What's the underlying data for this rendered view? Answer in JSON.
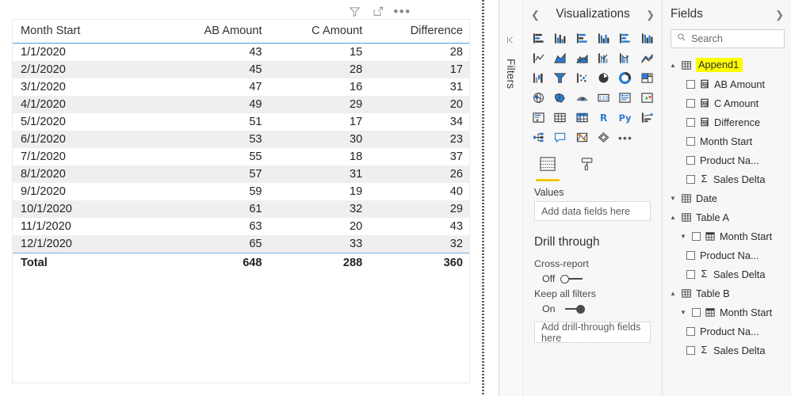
{
  "visual": {
    "toolbar": [
      {
        "name": "filter-icon",
        "label": "Filter"
      },
      {
        "name": "focus-mode-icon",
        "label": "Focus mode"
      },
      {
        "name": "more-options-icon",
        "label": "More options"
      }
    ],
    "table": {
      "columns": [
        "Month Start",
        "AB Amount",
        "C Amount",
        "Difference"
      ],
      "rows": [
        [
          "1/1/2020",
          "43",
          "15",
          "28"
        ],
        [
          "2/1/2020",
          "45",
          "28",
          "17"
        ],
        [
          "3/1/2020",
          "47",
          "16",
          "31"
        ],
        [
          "4/1/2020",
          "49",
          "29",
          "20"
        ],
        [
          "5/1/2020",
          "51",
          "17",
          "34"
        ],
        [
          "6/1/2020",
          "53",
          "30",
          "23"
        ],
        [
          "7/1/2020",
          "55",
          "18",
          "37"
        ],
        [
          "8/1/2020",
          "57",
          "31",
          "26"
        ],
        [
          "9/1/2020",
          "59",
          "19",
          "40"
        ],
        [
          "10/1/2020",
          "61",
          "32",
          "29"
        ],
        [
          "11/1/2020",
          "63",
          "20",
          "43"
        ],
        [
          "12/1/2020",
          "65",
          "33",
          "32"
        ]
      ],
      "total": [
        "Total",
        "648",
        "288",
        "360"
      ]
    }
  },
  "filters_rail": {
    "label": "Filters",
    "expand_icon": "expand-filters-icon"
  },
  "visualizations": {
    "title": "Visualizations",
    "collapse_icon": "chevron-left-icon",
    "expand_icon": "chevron-right-icon",
    "icons": [
      "stacked-bar-chart",
      "stacked-column-chart",
      "clustered-bar-chart",
      "clustered-column-chart",
      "100-stacked-bar-chart",
      "100-stacked-column-chart",
      "line-chart",
      "area-chart",
      "stacked-area-chart",
      "line-and-stacked-column-chart",
      "line-and-clustered-column-chart",
      "ribbon-chart",
      "waterfall-chart",
      "funnel-chart",
      "scatter-chart",
      "pie-chart",
      "donut-chart",
      "treemap",
      "map",
      "filled-map",
      "arcgis-map",
      "card",
      "multi-row-card",
      "kpi",
      "slicer",
      "table",
      "matrix",
      "r-script-visual",
      "python-visual",
      "key-influencers",
      "decomposition-tree",
      "q-and-a",
      "arcgis-maps-visual",
      "paginated-report",
      "more-visuals"
    ],
    "tabs": [
      {
        "label": "Fields",
        "icon": "fields-grid-icon",
        "active": true
      },
      {
        "label": "Format",
        "icon": "paint-roller-icon",
        "active": false
      }
    ],
    "values_label": "Values",
    "values_placeholder": "Add data fields here",
    "drill_through": {
      "title": "Drill through",
      "cross_report_label": "Cross-report",
      "cross_report_state": "Off",
      "keep_all_filters_label": "Keep all filters",
      "keep_all_filters_state": "On",
      "placeholder": "Add drill-through fields here"
    },
    "accent_color": "#f2c811"
  },
  "fields": {
    "title": "Fields",
    "expand_icon": "chevron-right-icon",
    "search_placeholder": "Search",
    "search_icon": "search-icon",
    "tables": [
      {
        "name": "Append1",
        "expanded": true,
        "highlighted": true,
        "fields": [
          {
            "label": "AB Amount",
            "icon": "measure-icon",
            "checked": false
          },
          {
            "label": "C Amount",
            "icon": "measure-icon",
            "checked": false
          },
          {
            "label": "Difference",
            "icon": "measure-icon",
            "checked": false
          },
          {
            "label": "Month Start",
            "icon": "none",
            "checked": false
          },
          {
            "label": "Product Na...",
            "icon": "none",
            "checked": false
          },
          {
            "label": "Sales Delta",
            "icon": "sigma-icon",
            "checked": false
          }
        ]
      },
      {
        "name": "Date",
        "expanded": false,
        "highlighted": false,
        "fields": []
      },
      {
        "name": "Table A",
        "expanded": true,
        "highlighted": false,
        "fields": [
          {
            "label": "Month Start",
            "icon": "calendar-icon",
            "checked": false,
            "caret": true
          },
          {
            "label": "Product Na...",
            "icon": "none",
            "checked": false
          },
          {
            "label": "Sales Delta",
            "icon": "sigma-icon",
            "checked": false
          }
        ]
      },
      {
        "name": "Table B",
        "expanded": true,
        "highlighted": false,
        "fields": [
          {
            "label": "Month Start",
            "icon": "calendar-icon",
            "checked": false,
            "caret": true
          },
          {
            "label": "Product Na...",
            "icon": "none",
            "checked": false
          },
          {
            "label": "Sales Delta",
            "icon": "sigma-icon",
            "checked": false
          }
        ]
      }
    ]
  }
}
